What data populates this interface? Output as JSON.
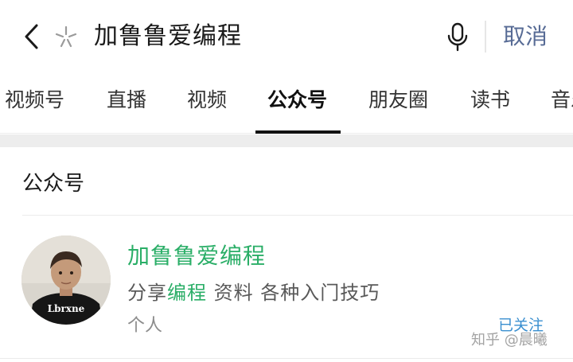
{
  "search": {
    "query": "加鲁鲁爱编程",
    "cancel_label": "取消"
  },
  "tabs": [
    {
      "label": "视频号"
    },
    {
      "label": "直播"
    },
    {
      "label": "视频"
    },
    {
      "label": "公众号",
      "active": true
    },
    {
      "label": "朋友圈"
    },
    {
      "label": "读书"
    },
    {
      "label": "音乐"
    }
  ],
  "section": {
    "title": "公众号"
  },
  "account": {
    "name": "加鲁鲁爱编程",
    "desc_before": "分享",
    "desc_highlight": "编程",
    "desc_after": " 资料 各种入门技巧",
    "type": "个人",
    "follow_status": "已关注",
    "avatar_shirt_text": "Lbrxne"
  },
  "watermark": "知乎 @晨曦",
  "colors": {
    "highlight_green": "#2aae67",
    "link_blue": "#576b95",
    "followed_blue": "#3a8fd0"
  },
  "icons": [
    "back-arrow-icon",
    "sparkle-icon",
    "microphone-icon"
  ]
}
